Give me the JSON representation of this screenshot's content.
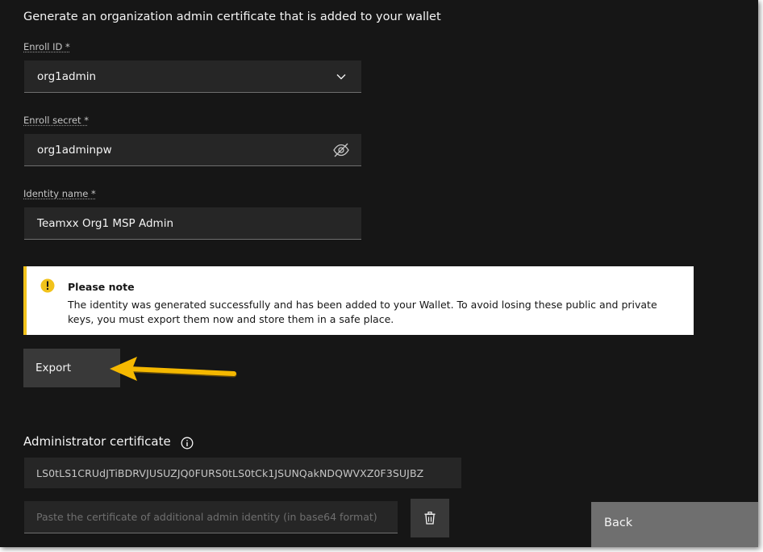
{
  "intro_text": "Generate an organization admin certificate that is added to your wallet",
  "enroll_id": {
    "label": "Enroll ID *",
    "value": "org1admin"
  },
  "enroll_secret": {
    "label": "Enroll secret *",
    "value": "org1adminpw"
  },
  "identity_name": {
    "label": "Identity name *",
    "value": "Teamxx Org1 MSP Admin"
  },
  "notice": {
    "title": "Please note",
    "message": "The identity was generated successfully and has been added to your Wallet. To avoid losing these public and private keys, you must export them now and store them in a safe place.",
    "color": "#f1c21b"
  },
  "export_button": "Export",
  "admin_certificate": {
    "title": "Administrator certificate",
    "value": "LS0tLS1CRUdJTiBDRVJUSUZJQ0FURS0tLS0tCk1JSUNQakNDQWVXZ0F3SUJBZ",
    "paste_placeholder": "Paste the certificate of additional admin identity (in base64 format)"
  },
  "back_button": "Back",
  "icons": {
    "dropdown": "chevron-down-icon",
    "visibility": "eye-off-icon",
    "warning": "warning-icon",
    "info": "info-icon",
    "trash": "trash-icon",
    "annotation": "arrow-annotation"
  },
  "colors": {
    "background": "#161616",
    "field": "#262626",
    "button": "#393939",
    "back_button": "#6f6f6f",
    "arrow": "#f5b800"
  }
}
